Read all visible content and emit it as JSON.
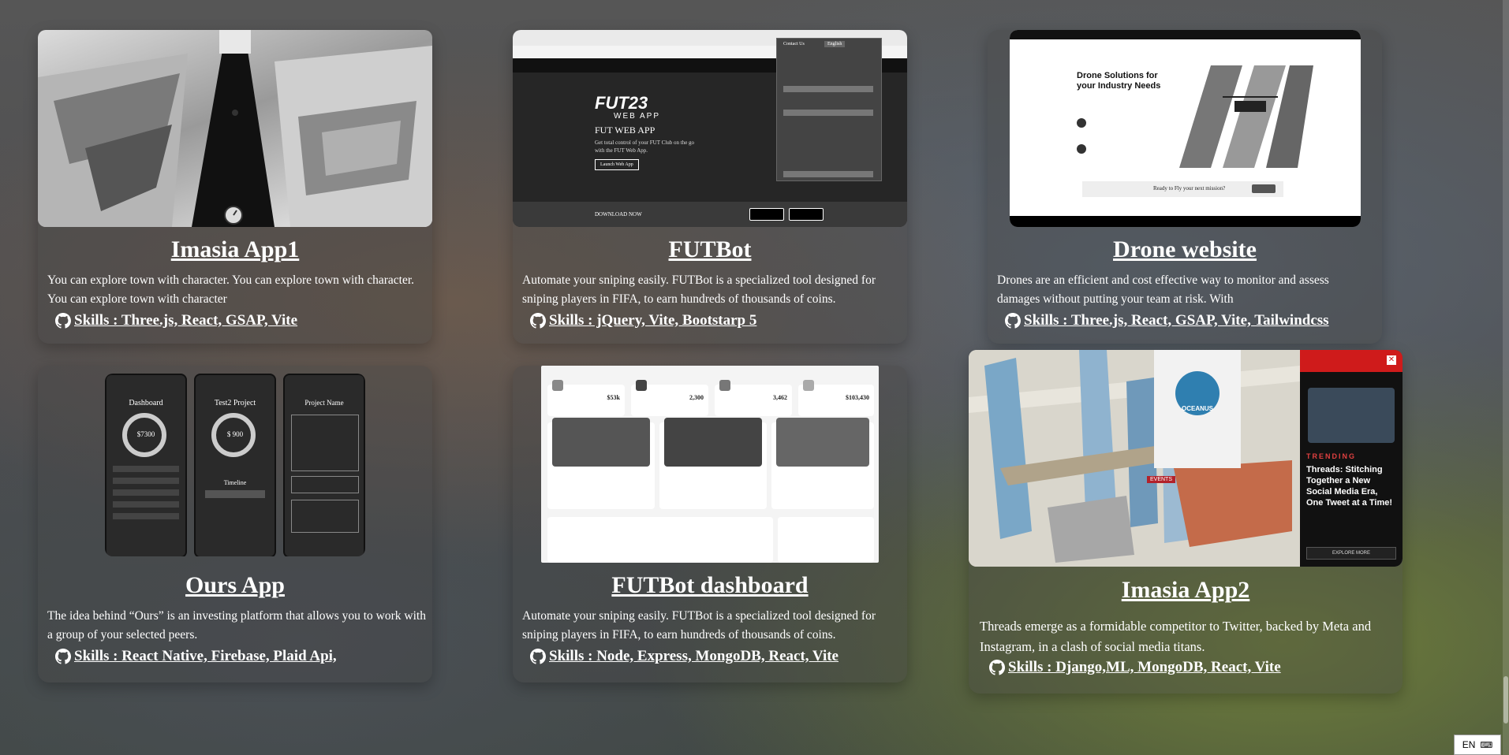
{
  "projects": [
    {
      "title": "Imasia App1",
      "description": "You can explore town with character. You can explore town with character. You can explore town with character",
      "skills": "Skills : Three.js, React, GSAP, Vite"
    },
    {
      "title": "FUTBot",
      "description": "Automate your sniping easily. FUTBot is a specialized tool designed for sniping players in FIFA, to earn hundreds of thousands of coins.",
      "skills": "Skills : jQuery, Vite, Bootstarp 5",
      "thumb_text": {
        "brand": "FUT23",
        "sub": "WEB APP",
        "heading": "FUT WEB APP",
        "lead": "Get total control of your FUT Club on the go with the FUT Web App.",
        "cta": "Launch Web App",
        "download": "DOWNLOAD NOW",
        "contact": "Contact Us",
        "lang": "English"
      }
    },
    {
      "title": "Drone website",
      "description": "Drones are an efficient and cost effective way to monitor and assess damages without putting your team at risk. With",
      "skills": "Skills : Three.js, React, GSAP, Vite, Tailwindcss",
      "thumb_text": {
        "heading": "Drone Solutions for your Industry Needs",
        "ready": "Ready to Fly your next mission?"
      }
    },
    {
      "title": "Ours App",
      "description": "The idea behind “Ours” is an investing platform that allows you to work with a group of your selected peers.",
      "skills": "Skills : React Native, Firebase, Plaid Api,",
      "thumb_text": {
        "s1_title": "Dashboard",
        "s1_value": "$7300",
        "s2_title": "Test2 Project",
        "s2_value": "$ 900",
        "s3_title": "Project Name",
        "timeline": "Timeline"
      }
    },
    {
      "title": "FUTBot dashboard",
      "description": "Automate your sniping easily. FUTBot is a specialized tool designed for sniping players in FIFA, to earn hundreds of thousands of coins.",
      "skills": "Skills : Node, Express, MongoDB, React, Vite",
      "thumb_text": {
        "k1": "$53k",
        "k2": "2,300",
        "k3": "3,462",
        "k4": "$103,430"
      }
    },
    {
      "title": "Imasia App2",
      "description": "Threads emerge as a formidable competitor to Twitter, backed by Meta and Instagram, in a clash of social media titans.",
      "skills": "Skills : Django,ML, MongoDB, React, Vite",
      "thumb_text": {
        "badge": "OCEANUS",
        "events": "EVENTS",
        "trending": "TRENDING",
        "headline": "Threads: Stitching Together a New Social Media Era, One Tweet at a Time!",
        "explore": "EXPLORE MORE"
      }
    }
  ],
  "lang_label": "EN"
}
